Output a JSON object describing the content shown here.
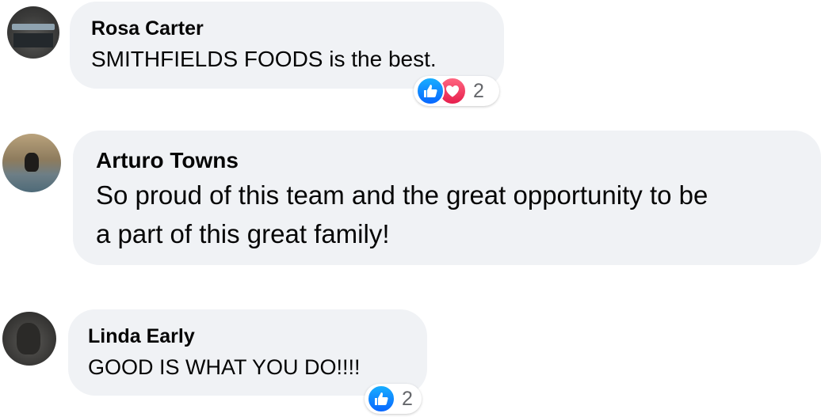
{
  "comments": [
    {
      "author": "Rosa Carter",
      "text": "SMITHFIELDS FOODS is the best.",
      "reactions": [
        "like-icon",
        "love-icon"
      ],
      "reaction_count": "2"
    },
    {
      "author": "Arturo Towns",
      "text_lines": [
        "So proud of this team and the great opportunity to be",
        "a part of this great family!"
      ]
    },
    {
      "author": "Linda Early",
      "text": "GOOD IS WHAT YOU DO!!!!",
      "reactions": [
        "like-icon"
      ],
      "reaction_count": "2"
    }
  ],
  "colors": {
    "bubble": "#f0f2f5",
    "like": "#0866ff",
    "love": "#e61e4d",
    "muted_text": "#65676b"
  }
}
